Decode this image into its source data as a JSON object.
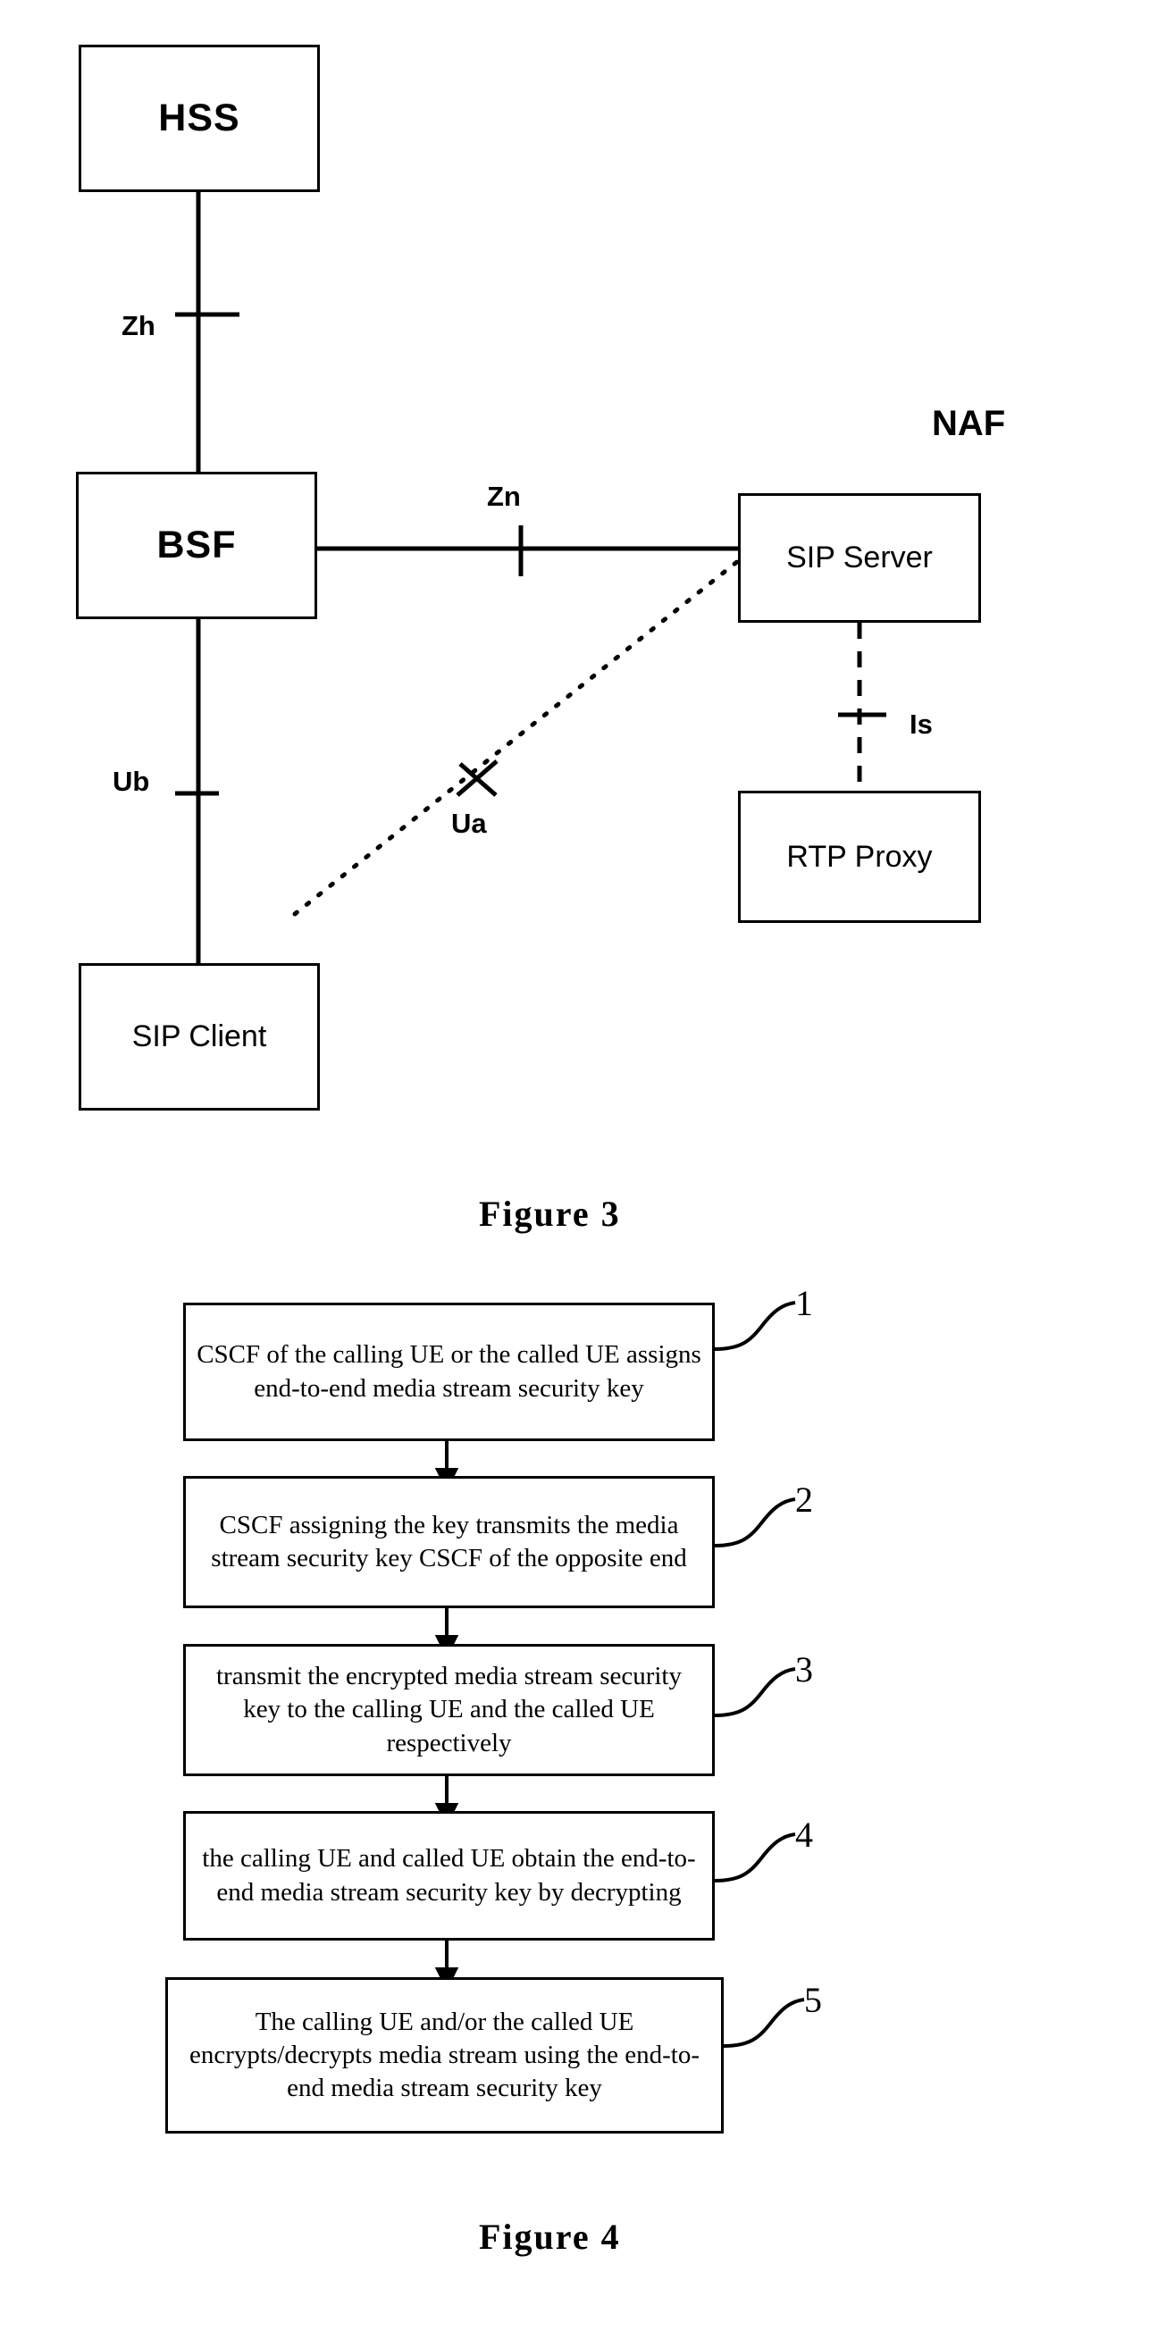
{
  "figure3": {
    "nodes": [
      {
        "id": "hss",
        "label": "HSS"
      },
      {
        "id": "bsf",
        "label": "BSF"
      },
      {
        "id": "sip_client",
        "label": "SIP Client"
      },
      {
        "id": "sip_server",
        "label": "SIP Server"
      },
      {
        "id": "rtp_proxy",
        "label": "RTP Proxy"
      }
    ],
    "group_label": "NAF",
    "interfaces": [
      {
        "id": "zh",
        "label": "Zh",
        "between": [
          "HSS",
          "BSF"
        ]
      },
      {
        "id": "zn",
        "label": "Zn",
        "between": [
          "BSF",
          "SIP Server"
        ]
      },
      {
        "id": "ub",
        "label": "Ub",
        "between": [
          "BSF",
          "SIP Client"
        ]
      },
      {
        "id": "ua",
        "label": "Ua",
        "between": [
          "SIP Client",
          "SIP Server"
        ]
      },
      {
        "id": "is",
        "label": "Is",
        "between": [
          "SIP Server",
          "RTP Proxy"
        ]
      }
    ],
    "caption": "Figure 3"
  },
  "figure4": {
    "steps": [
      {
        "number": "1",
        "text": "CSCF of the calling UE or the called UE assigns end-to-end media stream security key"
      },
      {
        "number": "2",
        "text": "CSCF assigning the key transmits the media stream security key  CSCF of the opposite end"
      },
      {
        "number": "3",
        "text": "transmit the encrypted media stream security key to the calling UE and the called UE respectively"
      },
      {
        "number": "4",
        "text": "the calling UE and called UE obtain the end-to-end media stream security key by decrypting"
      },
      {
        "number": "5",
        "text": "The calling UE and/or the called UE encrypts/decrypts media stream using the end-to-end media stream security key"
      }
    ],
    "caption": "Figure 4"
  }
}
